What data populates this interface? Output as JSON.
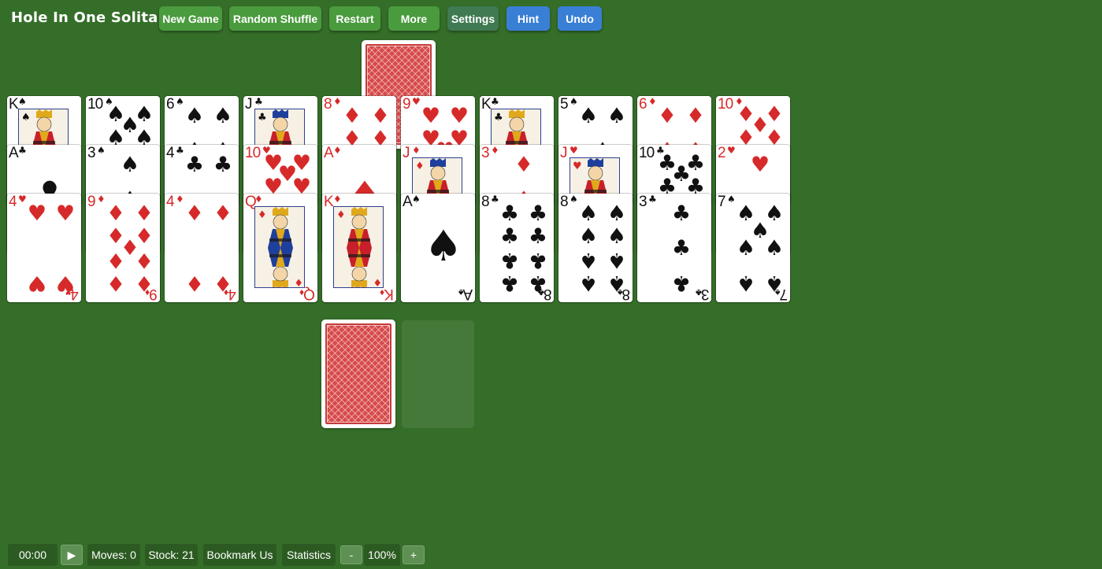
{
  "app": {
    "title": "Hole In One Solitaire"
  },
  "toolbar": {
    "new_game": "New Game",
    "random_shuffle": "Random Shuffle",
    "restart": "Restart",
    "more": "More",
    "settings": "Settings",
    "hint": "Hint",
    "undo": "Undo"
  },
  "colors": {
    "felt": "#356e29",
    "button_green": "#4a9a3e",
    "button_teal": "#3f7a52",
    "button_blue": "#3a7fd6",
    "card_red": "#d62a2a",
    "card_back": "#d74a4a"
  },
  "foundation": {
    "top_card": "face-down"
  },
  "tableau": [
    {
      "cards": [
        {
          "rank": "K",
          "suit": "♠"
        },
        {
          "rank": "A",
          "suit": "♣"
        },
        {
          "rank": "4",
          "suit": "♥"
        }
      ]
    },
    {
      "cards": [
        {
          "rank": "10",
          "suit": "♠"
        },
        {
          "rank": "3",
          "suit": "♠"
        },
        {
          "rank": "9",
          "suit": "♦"
        }
      ]
    },
    {
      "cards": [
        {
          "rank": "6",
          "suit": "♠"
        },
        {
          "rank": "4",
          "suit": "♣"
        },
        {
          "rank": "4",
          "suit": "♦"
        }
      ]
    },
    {
      "cards": [
        {
          "rank": "J",
          "suit": "♣"
        },
        {
          "rank": "10",
          "suit": "♥"
        },
        {
          "rank": "Q",
          "suit": "♦"
        }
      ]
    },
    {
      "cards": [
        {
          "rank": "8",
          "suit": "♦"
        },
        {
          "rank": "A",
          "suit": "♦"
        },
        {
          "rank": "K",
          "suit": "♦"
        }
      ]
    },
    {
      "cards": [
        {
          "rank": "9",
          "suit": "♥"
        },
        {
          "rank": "J",
          "suit": "♦"
        },
        {
          "rank": "A",
          "suit": "♠"
        }
      ]
    },
    {
      "cards": [
        {
          "rank": "K",
          "suit": "♣"
        },
        {
          "rank": "3",
          "suit": "♦"
        },
        {
          "rank": "8",
          "suit": "♣"
        }
      ]
    },
    {
      "cards": [
        {
          "rank": "5",
          "suit": "♠"
        },
        {
          "rank": "J",
          "suit": "♥"
        },
        {
          "rank": "8",
          "suit": "♠"
        }
      ]
    },
    {
      "cards": [
        {
          "rank": "6",
          "suit": "♦"
        },
        {
          "rank": "10",
          "suit": "♣"
        },
        {
          "rank": "3",
          "suit": "♣"
        }
      ]
    },
    {
      "cards": [
        {
          "rank": "10",
          "suit": "♦"
        },
        {
          "rank": "2",
          "suit": "♥"
        },
        {
          "rank": "7",
          "suit": "♠"
        }
      ]
    }
  ],
  "stock": {
    "state": "face-down"
  },
  "statusbar": {
    "timer": "00:00",
    "play_icon": "▶",
    "moves": "Moves: 0",
    "stock": "Stock: 21",
    "bookmark": "Bookmark Us",
    "statistics": "Statistics",
    "zoom_out": "-",
    "zoom": "100%",
    "zoom_in": "+"
  }
}
